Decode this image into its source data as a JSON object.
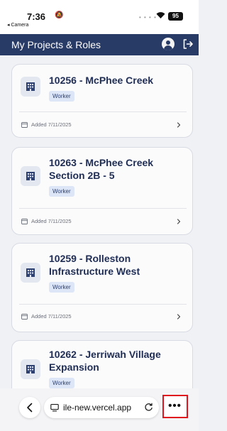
{
  "status_bar": {
    "time": "7:36",
    "back_app": "◂ Camera",
    "battery": "95"
  },
  "header": {
    "title": "My Projects & Roles"
  },
  "projects": [
    {
      "title": "10256 - McPhee Creek",
      "role": "Worker",
      "added": "Added 7/11/2025"
    },
    {
      "title": "10263 - McPhee Creek Section 2B - 5",
      "role": "Worker",
      "added": "Added 7/11/2025"
    },
    {
      "title": "10259 - Rolleston Infrastructure West",
      "role": "Worker",
      "added": "Added 7/11/2025"
    },
    {
      "title": "10262 - Jerriwah Village Expansion",
      "role": "Worker",
      "added": ""
    }
  ],
  "browser": {
    "url": "ile-new.vercel.app",
    "more_label": "•••"
  },
  "colors": {
    "header": "#283a66",
    "accent_badge": "#dde6f6",
    "highlight": "#e0141c"
  }
}
